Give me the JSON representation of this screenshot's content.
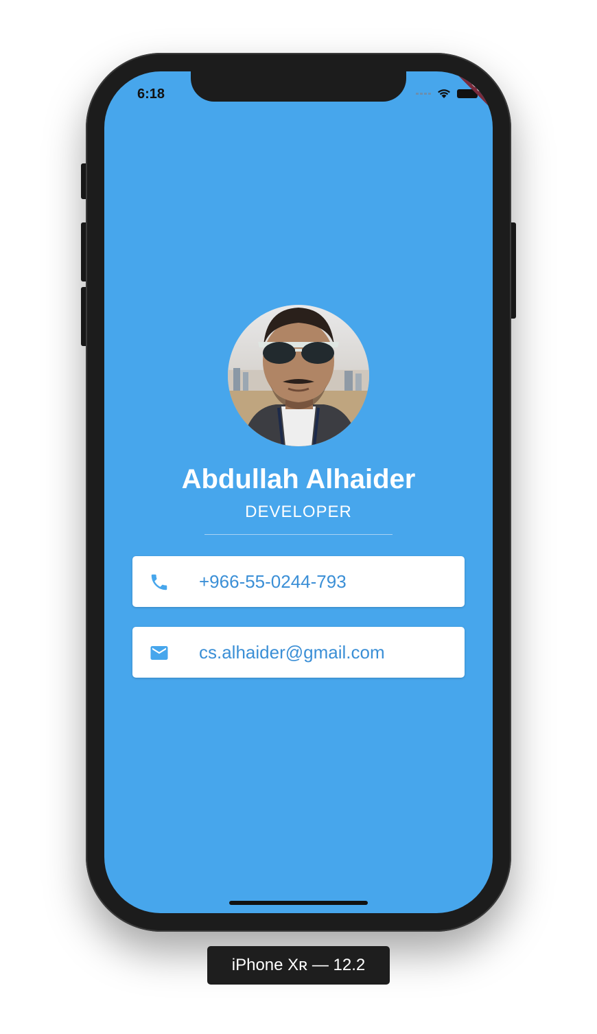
{
  "status_bar": {
    "time": "6:18"
  },
  "debug_banner": "DEBUG",
  "profile": {
    "name": "Abdullah Alhaider",
    "title": "DEVELOPER"
  },
  "contacts": {
    "phone": {
      "icon": "phone-icon",
      "value": "+966-55-0244-793"
    },
    "email": {
      "icon": "mail-icon",
      "value": "cs.alhaider@gmail.com"
    }
  },
  "simulator": {
    "device_label": "iPhone Xʀ — 12.2"
  },
  "colors": {
    "background": "#47a6ec",
    "card": "#ffffff",
    "card_text": "#3b8fd6",
    "debug_banner": "#7a2b3c"
  }
}
